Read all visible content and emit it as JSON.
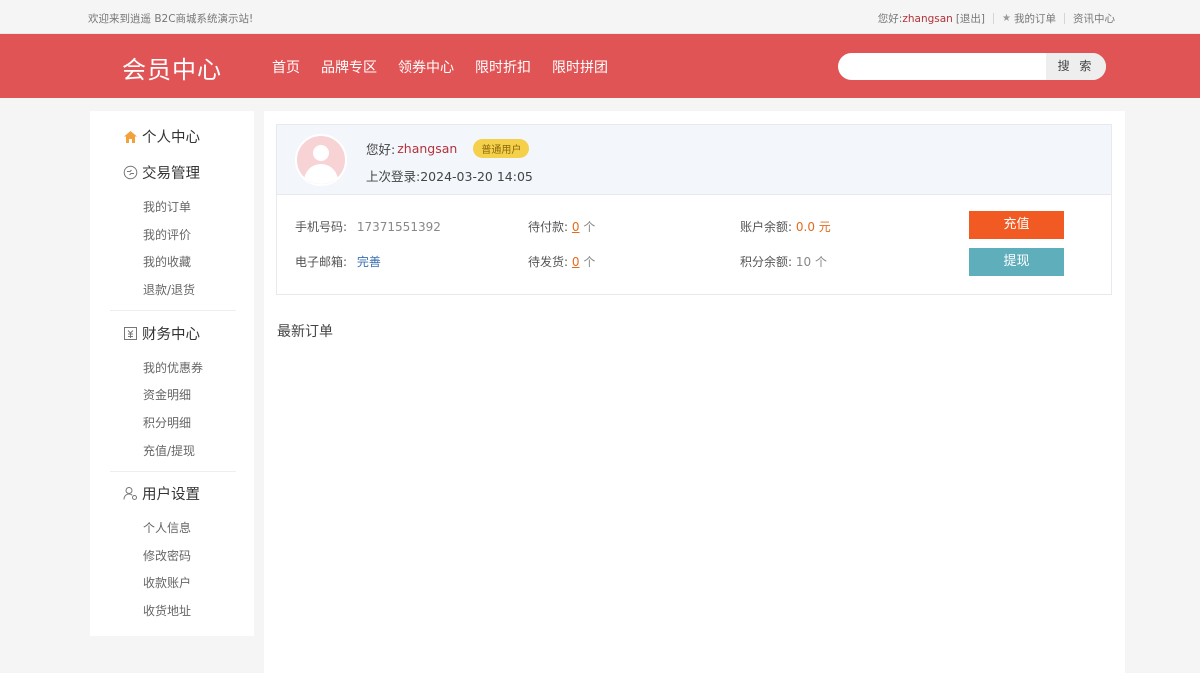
{
  "topbar": {
    "welcome": "欢迎来到逍遥 B2C商城系统演示站!",
    "hello_prefix": "您好:",
    "username": "zhangsan",
    "logout": "[退出]",
    "my_orders": "我的订单",
    "news_center": "资讯中心"
  },
  "header": {
    "logo": "会员中心",
    "nav": [
      "首页",
      "品牌专区",
      "领券中心",
      "限时折扣",
      "限时拼团"
    ],
    "search_placeholder": "",
    "search_button": "搜 索"
  },
  "sidebar": {
    "personal_center": "个人中心",
    "trade": {
      "title": "交易管理",
      "items": [
        "我的订单",
        "我的评价",
        "我的收藏",
        "退款/退货"
      ]
    },
    "finance": {
      "title": "财务中心",
      "items": [
        "我的优惠券",
        "资金明细",
        "积分明细",
        "充值/提现"
      ]
    },
    "settings": {
      "title": "用户设置",
      "items": [
        "个人信息",
        "修改密码",
        "收款账户",
        "收货地址"
      ]
    }
  },
  "profile": {
    "hello_prefix": "您好:",
    "username": "zhangsan",
    "badge": "普通用户",
    "last_login_label": "上次登录:",
    "last_login": "2024-03-20 14:05",
    "phone_label": "手机号码:",
    "phone": "17371551392",
    "email_label": "电子邮箱:",
    "email_action": "完善",
    "pending_pay_label": "待付款:",
    "pending_pay": "0",
    "pending_ship_label": "待发货:",
    "pending_ship": "0",
    "unit_count": "个",
    "balance_label": "账户余额:",
    "balance": "0.0 元",
    "points_label": "积分余额:",
    "points": "10 个",
    "recharge_button": "充值",
    "withdraw_button": "提现"
  },
  "latest_orders_title": "最新订单",
  "colors": {
    "brand_red": "#e05456",
    "recharge": "#f25a23",
    "withdraw": "#5faebb",
    "badge": "#f5d04a"
  },
  "icons": {
    "personal_center": "home-icon",
    "trade": "exchange-icon",
    "finance": "ledger-icon",
    "settings": "user-gear-icon",
    "my_orders": "star-icon"
  }
}
